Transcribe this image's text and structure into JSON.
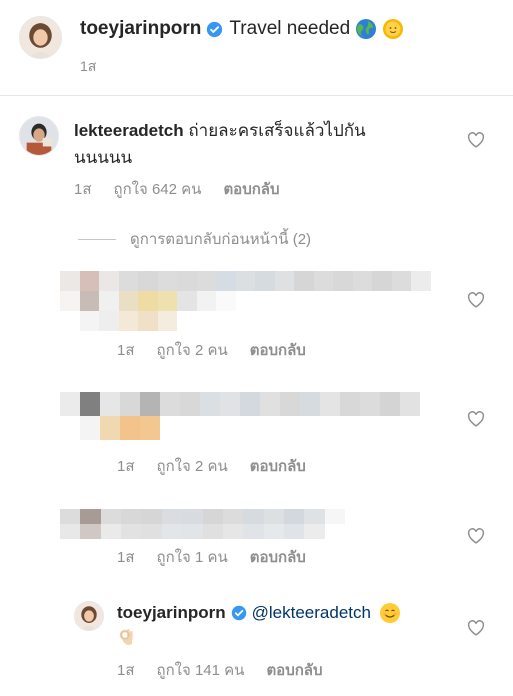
{
  "post": {
    "username": "toeyjarinporn",
    "caption": "Travel needed",
    "caption_emojis": [
      "globe-emoji",
      "sun-face-emoji"
    ],
    "time": "1ส"
  },
  "comment": {
    "username": "lekteeradetch",
    "text_line1": "ถ่ายละครเสร็จแล้วไปกัน",
    "text_line2": "นนนนน",
    "time": "1ส",
    "likes": "ถูกใจ 642 คน",
    "reply_label": "ตอบกลับ"
  },
  "view_previous_replies": "ดูการตอบกลับก่อนหน้านี้ (2)",
  "blurred_replies": [
    {
      "time": "1ส",
      "likes": "ถูกใจ 2 คน",
      "reply_label": "ตอบกลับ"
    },
    {
      "time": "1ส",
      "likes": "ถูกใจ 2 คน",
      "reply_label": "ตอบกลับ"
    },
    {
      "time": "1ส",
      "likes": "ถูกใจ 1 คน",
      "reply_label": "ตอบกลับ"
    }
  ],
  "last_reply": {
    "username": "toeyjarinporn",
    "mention": "@lekteeradetch",
    "emojis": [
      "smiling-face-emoji",
      "ok-hand-emoji"
    ],
    "time": "1ส",
    "likes": "ถูกใจ 141 คน",
    "reply_label": "ตอบกลับ"
  },
  "colors": {
    "text": "#262626",
    "secondary": "#8e8e8e",
    "verified": "#3897f0",
    "mention": "#003569",
    "divider": "#e6e6e6"
  }
}
